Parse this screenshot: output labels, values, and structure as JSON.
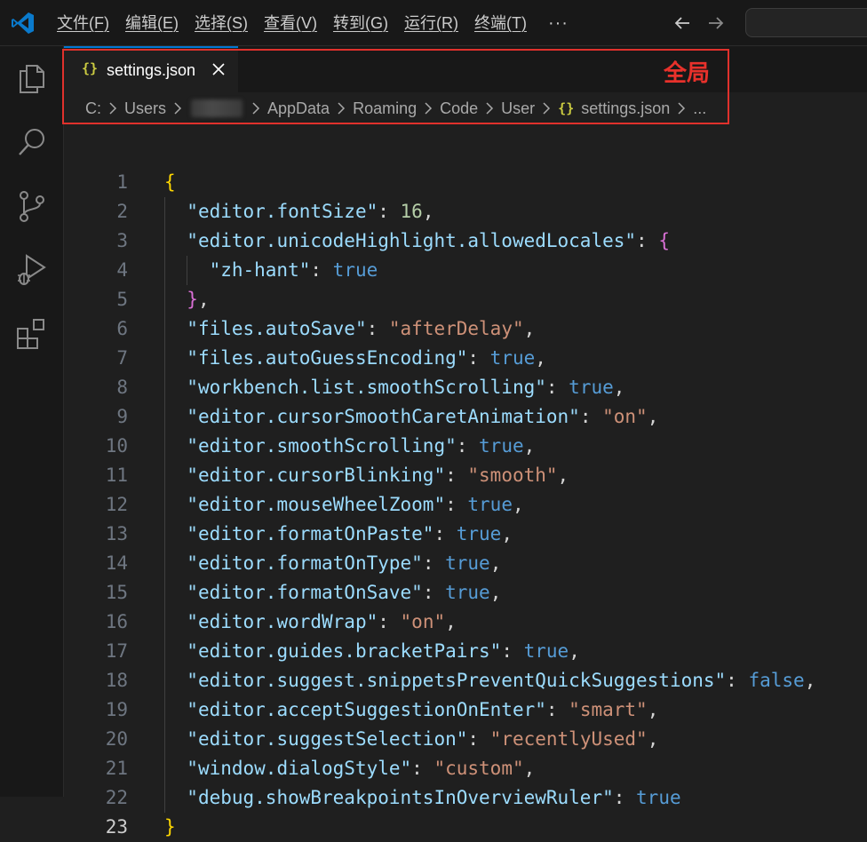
{
  "menu": {
    "items": [
      "文件(F)",
      "编辑(E)",
      "选择(S)",
      "查看(V)",
      "转到(G)",
      "运行(R)",
      "终端(T)"
    ],
    "more": "···"
  },
  "icons": {
    "logo": "vscode-logo-icon",
    "back": "arrow-left-icon",
    "forward": "arrow-right-icon",
    "activity": [
      "explorer-icon",
      "search-icon",
      "source-control-icon",
      "run-debug-icon",
      "extensions-icon"
    ]
  },
  "colors": {
    "accent": "#0078d4",
    "highlight_border": "#e0312c",
    "key": "#9cdcfe",
    "string": "#ce9178",
    "number": "#b5cea8",
    "boolean": "#569cd6",
    "bracket_level1": "#ffd700",
    "bracket_level2": "#da70d6"
  },
  "tab": {
    "icon_text": "{}",
    "label": "settings.json"
  },
  "breadcrumb": {
    "segments": [
      "C:",
      "Users",
      "AppData",
      "Roaming",
      "Code",
      "User"
    ],
    "file_icon": "{}",
    "file": "settings.json",
    "ellipsis": "..."
  },
  "annotation": {
    "label": "全局"
  },
  "editor": {
    "lines": [
      {
        "n": "1",
        "tokens": [
          {
            "t": "{",
            "c": "br1"
          }
        ]
      },
      {
        "n": "2",
        "tokens": [
          {
            "t": "  ",
            "c": "p"
          },
          {
            "t": "\"editor.fontSize\"",
            "c": "k"
          },
          {
            "t": ": ",
            "c": "p"
          },
          {
            "t": "16",
            "c": "n"
          },
          {
            "t": ",",
            "c": "p"
          }
        ]
      },
      {
        "n": "3",
        "tokens": [
          {
            "t": "  ",
            "c": "p"
          },
          {
            "t": "\"editor.unicodeHighlight.allowedLocales\"",
            "c": "k"
          },
          {
            "t": ": ",
            "c": "p"
          },
          {
            "t": "{",
            "c": "br2"
          }
        ]
      },
      {
        "n": "4",
        "tokens": [
          {
            "t": "    ",
            "c": "p"
          },
          {
            "t": "\"zh-hant\"",
            "c": "k"
          },
          {
            "t": ": ",
            "c": "p"
          },
          {
            "t": "true",
            "c": "b"
          }
        ]
      },
      {
        "n": "5",
        "tokens": [
          {
            "t": "  ",
            "c": "p"
          },
          {
            "t": "}",
            "c": "br2"
          },
          {
            "t": ",",
            "c": "p"
          }
        ]
      },
      {
        "n": "6",
        "tokens": [
          {
            "t": "  ",
            "c": "p"
          },
          {
            "t": "\"files.autoSave\"",
            "c": "k"
          },
          {
            "t": ": ",
            "c": "p"
          },
          {
            "t": "\"afterDelay\"",
            "c": "s"
          },
          {
            "t": ",",
            "c": "p"
          }
        ]
      },
      {
        "n": "7",
        "tokens": [
          {
            "t": "  ",
            "c": "p"
          },
          {
            "t": "\"files.autoGuessEncoding\"",
            "c": "k"
          },
          {
            "t": ": ",
            "c": "p"
          },
          {
            "t": "true",
            "c": "b"
          },
          {
            "t": ",",
            "c": "p"
          }
        ]
      },
      {
        "n": "8",
        "tokens": [
          {
            "t": "  ",
            "c": "p"
          },
          {
            "t": "\"workbench.list.smoothScrolling\"",
            "c": "k"
          },
          {
            "t": ": ",
            "c": "p"
          },
          {
            "t": "true",
            "c": "b"
          },
          {
            "t": ",",
            "c": "p"
          }
        ]
      },
      {
        "n": "9",
        "tokens": [
          {
            "t": "  ",
            "c": "p"
          },
          {
            "t": "\"editor.cursorSmoothCaretAnimation\"",
            "c": "k"
          },
          {
            "t": ": ",
            "c": "p"
          },
          {
            "t": "\"on\"",
            "c": "s"
          },
          {
            "t": ",",
            "c": "p"
          }
        ]
      },
      {
        "n": "10",
        "tokens": [
          {
            "t": "  ",
            "c": "p"
          },
          {
            "t": "\"editor.smoothScrolling\"",
            "c": "k"
          },
          {
            "t": ": ",
            "c": "p"
          },
          {
            "t": "true",
            "c": "b"
          },
          {
            "t": ",",
            "c": "p"
          }
        ]
      },
      {
        "n": "11",
        "tokens": [
          {
            "t": "  ",
            "c": "p"
          },
          {
            "t": "\"editor.cursorBlinking\"",
            "c": "k"
          },
          {
            "t": ": ",
            "c": "p"
          },
          {
            "t": "\"smooth\"",
            "c": "s"
          },
          {
            "t": ",",
            "c": "p"
          }
        ]
      },
      {
        "n": "12",
        "tokens": [
          {
            "t": "  ",
            "c": "p"
          },
          {
            "t": "\"editor.mouseWheelZoom\"",
            "c": "k"
          },
          {
            "t": ": ",
            "c": "p"
          },
          {
            "t": "true",
            "c": "b"
          },
          {
            "t": ",",
            "c": "p"
          }
        ]
      },
      {
        "n": "13",
        "tokens": [
          {
            "t": "  ",
            "c": "p"
          },
          {
            "t": "\"editor.formatOnPaste\"",
            "c": "k"
          },
          {
            "t": ": ",
            "c": "p"
          },
          {
            "t": "true",
            "c": "b"
          },
          {
            "t": ",",
            "c": "p"
          }
        ]
      },
      {
        "n": "14",
        "tokens": [
          {
            "t": "  ",
            "c": "p"
          },
          {
            "t": "\"editor.formatOnType\"",
            "c": "k"
          },
          {
            "t": ": ",
            "c": "p"
          },
          {
            "t": "true",
            "c": "b"
          },
          {
            "t": ",",
            "c": "p"
          }
        ]
      },
      {
        "n": "15",
        "tokens": [
          {
            "t": "  ",
            "c": "p"
          },
          {
            "t": "\"editor.formatOnSave\"",
            "c": "k"
          },
          {
            "t": ": ",
            "c": "p"
          },
          {
            "t": "true",
            "c": "b"
          },
          {
            "t": ",",
            "c": "p"
          }
        ]
      },
      {
        "n": "16",
        "tokens": [
          {
            "t": "  ",
            "c": "p"
          },
          {
            "t": "\"editor.wordWrap\"",
            "c": "k"
          },
          {
            "t": ": ",
            "c": "p"
          },
          {
            "t": "\"on\"",
            "c": "s"
          },
          {
            "t": ",",
            "c": "p"
          }
        ]
      },
      {
        "n": "17",
        "tokens": [
          {
            "t": "  ",
            "c": "p"
          },
          {
            "t": "\"editor.guides.bracketPairs\"",
            "c": "k"
          },
          {
            "t": ": ",
            "c": "p"
          },
          {
            "t": "true",
            "c": "b"
          },
          {
            "t": ",",
            "c": "p"
          }
        ]
      },
      {
        "n": "18",
        "tokens": [
          {
            "t": "  ",
            "c": "p"
          },
          {
            "t": "\"editor.suggest.snippetsPreventQuickSuggestions\"",
            "c": "k"
          },
          {
            "t": ": ",
            "c": "p"
          },
          {
            "t": "false",
            "c": "b"
          },
          {
            "t": ",",
            "c": "p"
          }
        ]
      },
      {
        "n": "19",
        "tokens": [
          {
            "t": "  ",
            "c": "p"
          },
          {
            "t": "\"editor.acceptSuggestionOnEnter\"",
            "c": "k"
          },
          {
            "t": ": ",
            "c": "p"
          },
          {
            "t": "\"smart\"",
            "c": "s"
          },
          {
            "t": ",",
            "c": "p"
          }
        ]
      },
      {
        "n": "20",
        "tokens": [
          {
            "t": "  ",
            "c": "p"
          },
          {
            "t": "\"editor.suggestSelection\"",
            "c": "k"
          },
          {
            "t": ": ",
            "c": "p"
          },
          {
            "t": "\"recentlyUsed\"",
            "c": "s"
          },
          {
            "t": ",",
            "c": "p"
          }
        ]
      },
      {
        "n": "21",
        "tokens": [
          {
            "t": "  ",
            "c": "p"
          },
          {
            "t": "\"window.dialogStyle\"",
            "c": "k"
          },
          {
            "t": ": ",
            "c": "p"
          },
          {
            "t": "\"custom\"",
            "c": "s"
          },
          {
            "t": ",",
            "c": "p"
          }
        ]
      },
      {
        "n": "22",
        "tokens": [
          {
            "t": "  ",
            "c": "p"
          },
          {
            "t": "\"debug.showBreakpointsInOverviewRuler\"",
            "c": "k"
          },
          {
            "t": ": ",
            "c": "p"
          },
          {
            "t": "true",
            "c": "b"
          }
        ]
      },
      {
        "n": "23",
        "tokens": [
          {
            "t": "}",
            "c": "br1"
          }
        ]
      }
    ]
  }
}
